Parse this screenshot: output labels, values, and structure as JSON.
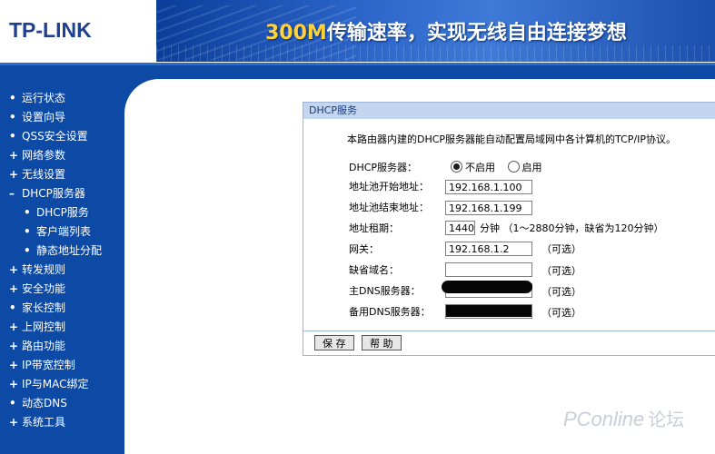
{
  "header": {
    "logo": "TP-LINK",
    "slogan_em": "300M",
    "slogan_rest": "传输速率，实现无线自由连接梦想"
  },
  "nav": {
    "items": [
      {
        "bullet": "•",
        "label": "运行状态"
      },
      {
        "bullet": "•",
        "label": "设置向导"
      },
      {
        "bullet": "•",
        "label": "QSS安全设置"
      },
      {
        "bullet": "+",
        "label": "网络参数"
      },
      {
        "bullet": "+",
        "label": "无线设置"
      },
      {
        "bullet": "–",
        "label": "DHCP服务器"
      },
      {
        "bullet": "•",
        "label": "DHCP服务"
      },
      {
        "bullet": "•",
        "label": "客户端列表"
      },
      {
        "bullet": "•",
        "label": "静态地址分配"
      },
      {
        "bullet": "+",
        "label": "转发规则"
      },
      {
        "bullet": "+",
        "label": "安全功能"
      },
      {
        "bullet": "•",
        "label": "家长控制"
      },
      {
        "bullet": "+",
        "label": "上网控制"
      },
      {
        "bullet": "+",
        "label": "路由功能"
      },
      {
        "bullet": "+",
        "label": "IP带宽控制"
      },
      {
        "bullet": "+",
        "label": "IP与MAC绑定"
      },
      {
        "bullet": "•",
        "label": "动态DNS"
      },
      {
        "bullet": "+",
        "label": "系统工具"
      }
    ]
  },
  "panel": {
    "title": "DHCP服务",
    "description": "本路由器内建的DHCP服务器能自动配置局域网中各计算机的TCP/IP协议。",
    "dhcp_server_label": "DHCP服务器：",
    "radio_disabled": "不启用",
    "radio_enabled": "启用",
    "pool_start_label": "地址池开始地址：",
    "pool_start_value": "192.168.1.100",
    "pool_end_label": "地址池结束地址：",
    "pool_end_value": "192.168.1.199",
    "lease_label": "地址租期：",
    "lease_value": "1440",
    "lease_hint": "分钟 （1～2880分钟，缺省为120分钟）",
    "gateway_label": "网关：",
    "gateway_value": "192.168.1.2",
    "domain_label": "缺省域名：",
    "domain_value": "",
    "dns1_label": "主DNS服务器：",
    "dns2_label": "备用DNS服务器：",
    "optional": "（可选）",
    "save_button": "保 存",
    "help_button": "帮 助"
  },
  "watermark": {
    "brand": "PConline",
    "site": "论坛"
  },
  "colors": {
    "nav_bg": "#0d4aa5",
    "panel_title_bg": "#c4d6ef",
    "banner_accent": "#ffd23a"
  }
}
